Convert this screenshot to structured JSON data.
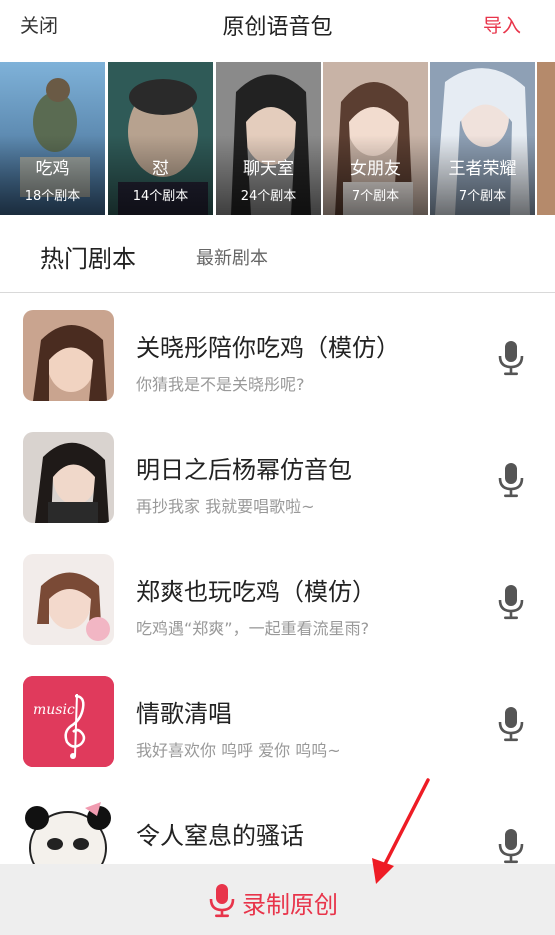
{
  "header": {
    "close": "关闭",
    "title": "原创语音包",
    "import": "导入"
  },
  "categories": [
    {
      "name": "吃鸡",
      "count": "18个剧本",
      "color": "#4a7fa6"
    },
    {
      "name": "怼",
      "count": "14个剧本",
      "color": "#3d6a63"
    },
    {
      "name": "聊天室",
      "count": "24个剧本",
      "color": "#6b6b6b"
    },
    {
      "name": "女朋友",
      "count": "7个剧本",
      "color": "#b79c8e"
    },
    {
      "name": "王者荣耀",
      "count": "7个剧本",
      "color": "#7f8fa3"
    }
  ],
  "tabs": {
    "hot": "热门剧本",
    "new": "最新剧本"
  },
  "items": [
    {
      "title": "关晓彤陪你吃鸡（模仿）",
      "subtitle": "你猜我是不是关晓彤呢?"
    },
    {
      "title": "明日之后杨幂仿音包",
      "subtitle": "再抄我家 我就要唱歌啦~"
    },
    {
      "title": "郑爽也玩吃鸡（模仿）",
      "subtitle": "吃鸡遇“郑爽”，一起重看流星雨?"
    },
    {
      "title": "情歌清唱",
      "subtitle": "我好喜欢你 呜呼 爱你 呜呜~",
      "thumb_text": "music"
    },
    {
      "title": "令人窒息的骚话",
      "subtitle": ""
    }
  ],
  "bottom": {
    "record_label": "录制原创"
  },
  "colors": {
    "accent": "#e8344a",
    "icon_gray": "#555555",
    "arrow": "#ee1c25"
  }
}
